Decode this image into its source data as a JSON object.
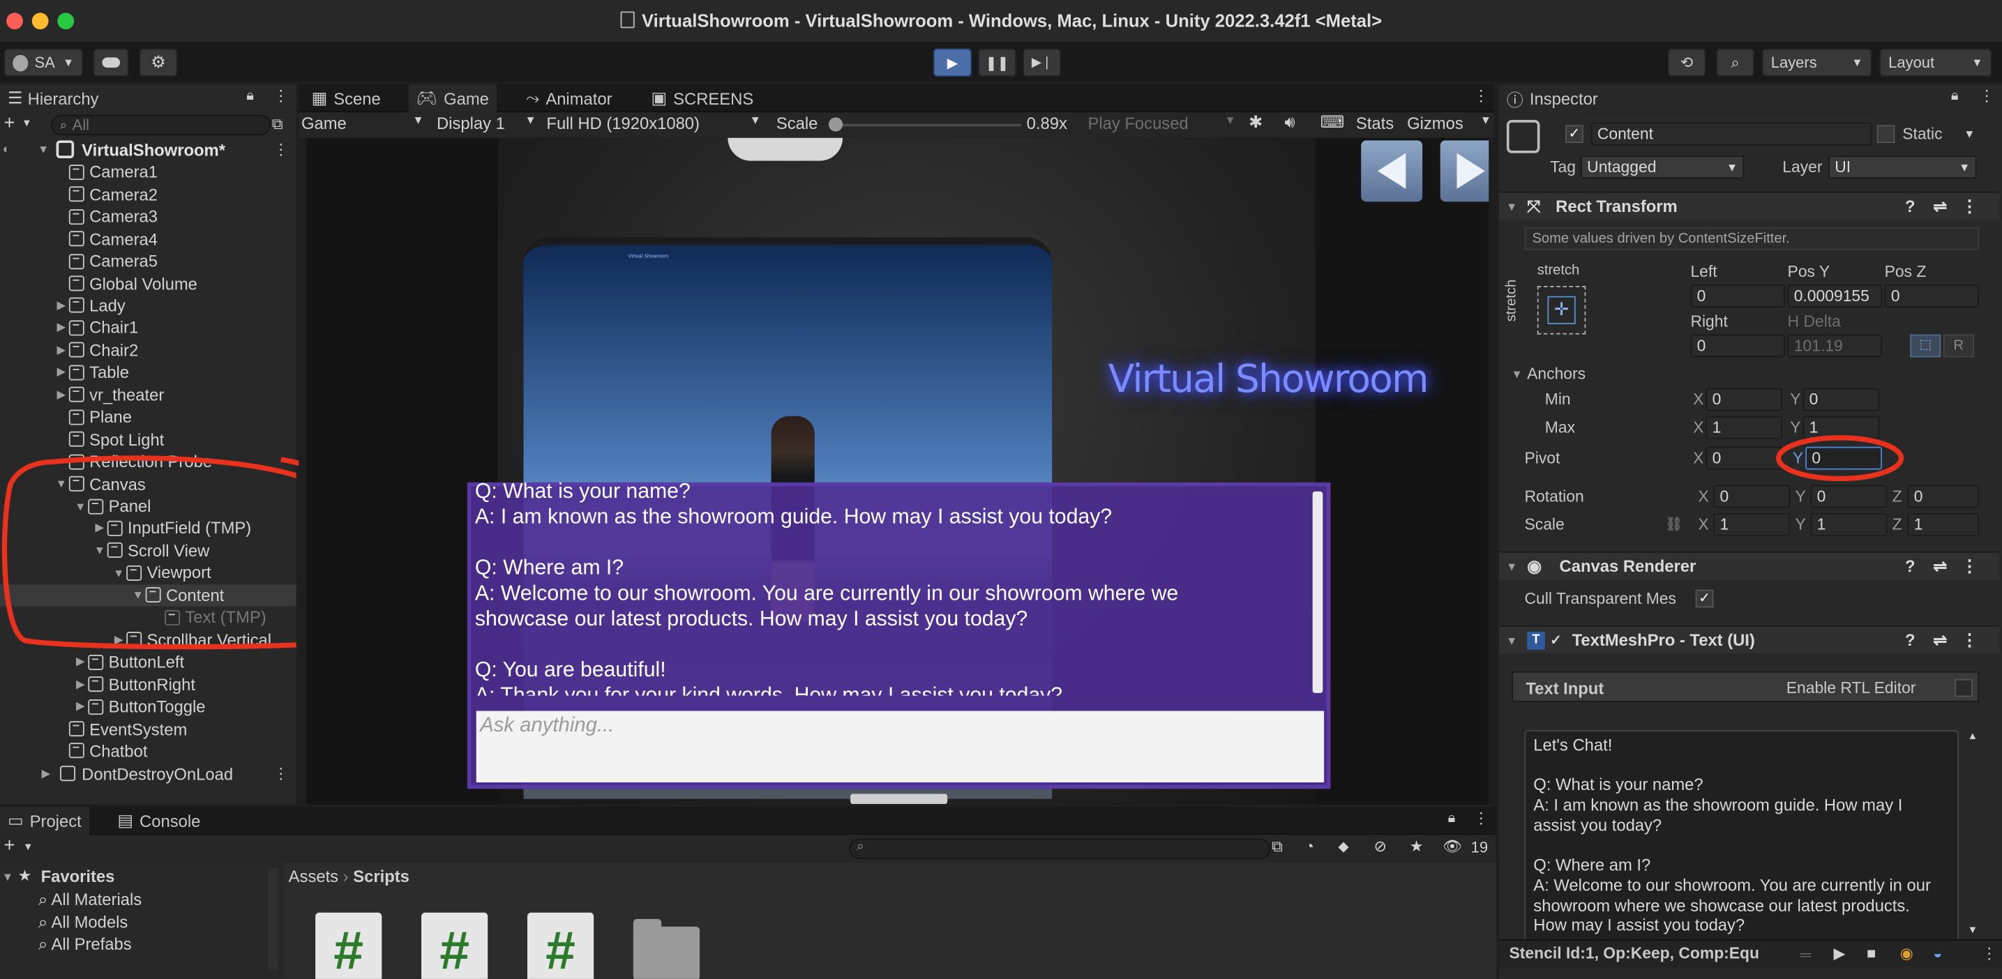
{
  "window": {
    "title": "VirtualShowroom - VirtualShowroom - Windows, Mac, Linux - Unity 2022.3.42f1 <Metal>"
  },
  "toolbar": {
    "account": "SA",
    "layers": "Layers",
    "layout": "Layout"
  },
  "hierarchy": {
    "tab": "Hierarchy",
    "search_placeholder": "All",
    "scene": "VirtualShowroom*",
    "items": [
      {
        "label": "Camera1",
        "depth": 1,
        "arrow": ""
      },
      {
        "label": "Camera2",
        "depth": 1,
        "arrow": ""
      },
      {
        "label": "Camera3",
        "depth": 1,
        "arrow": ""
      },
      {
        "label": "Camera4",
        "depth": 1,
        "arrow": ""
      },
      {
        "label": "Camera5",
        "depth": 1,
        "arrow": ""
      },
      {
        "label": "Global Volume",
        "depth": 1,
        "arrow": ""
      },
      {
        "label": "Lady",
        "depth": 1,
        "arrow": "right"
      },
      {
        "label": "Chair1",
        "depth": 1,
        "arrow": "right"
      },
      {
        "label": "Chair2",
        "depth": 1,
        "arrow": "right"
      },
      {
        "label": "Table",
        "depth": 1,
        "arrow": "right"
      },
      {
        "label": "vr_theater",
        "depth": 1,
        "arrow": "right"
      },
      {
        "label": "Plane",
        "depth": 1,
        "arrow": ""
      },
      {
        "label": "Spot Light",
        "depth": 1,
        "arrow": ""
      },
      {
        "label": "Reflection Probe",
        "depth": 1,
        "arrow": ""
      },
      {
        "label": "Canvas",
        "depth": 1,
        "arrow": "down"
      },
      {
        "label": "Panel",
        "depth": 2,
        "arrow": "down"
      },
      {
        "label": "InputField (TMP)",
        "depth": 3,
        "arrow": "right"
      },
      {
        "label": "Scroll View",
        "depth": 3,
        "arrow": "down"
      },
      {
        "label": "Viewport",
        "depth": 4,
        "arrow": "down"
      },
      {
        "label": "Content",
        "depth": 5,
        "arrow": "down"
      },
      {
        "label": "Text (TMP)",
        "depth": 6,
        "arrow": ""
      },
      {
        "label": "Scrollbar Vertical",
        "depth": 4,
        "arrow": "right"
      },
      {
        "label": "ButtonLeft",
        "depth": 2,
        "arrow": "right"
      },
      {
        "label": "ButtonRight",
        "depth": 2,
        "arrow": "right"
      },
      {
        "label": "ButtonToggle",
        "depth": 2,
        "arrow": "right"
      },
      {
        "label": "EventSystem",
        "depth": 1,
        "arrow": ""
      },
      {
        "label": "Chatbot",
        "depth": 1,
        "arrow": ""
      }
    ],
    "dont_destroy": "DontDestroyOnLoad"
  },
  "center_tabs": [
    "Scene",
    "Game",
    "Animator",
    "SCREENS"
  ],
  "game_bar": {
    "mode": "Game",
    "display": "Display 1",
    "resolution": "Full HD (1920x1080)",
    "scale_label": "Scale",
    "scale_value": "0.89x",
    "play_focused": "Play Focused",
    "stats": "Stats",
    "gizmos": "Gizmos"
  },
  "game": {
    "sign": "Virtual Showroom",
    "screen_caption": "Virtual Showroom",
    "chat_lines": [
      "Q: What is your name?",
      "A: I am known as the showroom guide. How may I assist you today?",
      "",
      "Q: Where am I?",
      "A: Welcome to our showroom. You are currently in our showroom where we",
      "showcase our latest products. How may I assist you today?",
      "",
      "Q: You are beautiful!",
      "A: Thank you for your kind words. How may I assist you today?"
    ],
    "input_placeholder": "Ask anything..."
  },
  "inspector": {
    "tab": "Inspector",
    "object_name": "Content",
    "static": "Static",
    "tag_label": "Tag",
    "tag": "Untagged",
    "layer_label": "Layer",
    "layer": "UI",
    "rect": {
      "title": "Rect Transform",
      "note": "Some values driven by ContentSizeFitter.",
      "stretch": "stretch",
      "left_label": "Left",
      "left": "0",
      "posy_label": "Pos Y",
      "posy": "0.0009155",
      "posz_label": "Pos Z",
      "posz": "0",
      "right_label": "Right",
      "right": "0",
      "hdelta_label": "H Delta",
      "hdelta": "101.19",
      "r": "R",
      "anchors": "Anchors",
      "min": "Min",
      "max": "Max",
      "min_x": "0",
      "min_y": "0",
      "max_x": "1",
      "max_y": "1",
      "pivot": "Pivot",
      "pivot_x": "0",
      "pivot_y": "0",
      "rotation": "Rotation",
      "rot_x": "0",
      "rot_y": "0",
      "rot_z": "0",
      "scale": "Scale",
      "sc_x": "1",
      "sc_y": "1",
      "sc_z": "1"
    },
    "canvas_renderer": {
      "title": "Canvas Renderer",
      "cull": "Cull Transparent Mes"
    },
    "tmp": {
      "title": "TextMeshPro - Text (UI)",
      "text_input": "Text Input",
      "rtl": "Enable RTL Editor",
      "text": "Let's Chat!\n\nQ: What is your name?\nA: I am known as the showroom guide. How may I\nassist you today?\n\nQ: Where am I?\nA: Welcome to our showroom. You are currently in our\nshowroom where we showcase our latest products.\nHow may I assist you today?"
    },
    "status": "Stencil Id:1, Op:Keep, Comp:Equ"
  },
  "project": {
    "tabs": [
      "Project",
      "Console"
    ],
    "favorites": "Favorites",
    "fav_items": [
      "All Materials",
      "All Models",
      "All Prefabs"
    ],
    "breadcrumb_root": "Assets",
    "breadcrumb_leaf": "Scripts",
    "count": "19"
  },
  "colors": {
    "chat_bg": "#4e2d93",
    "highlight": "#e8321e",
    "sign": "#6b7bff",
    "selected_row": "#3a3a3a"
  }
}
